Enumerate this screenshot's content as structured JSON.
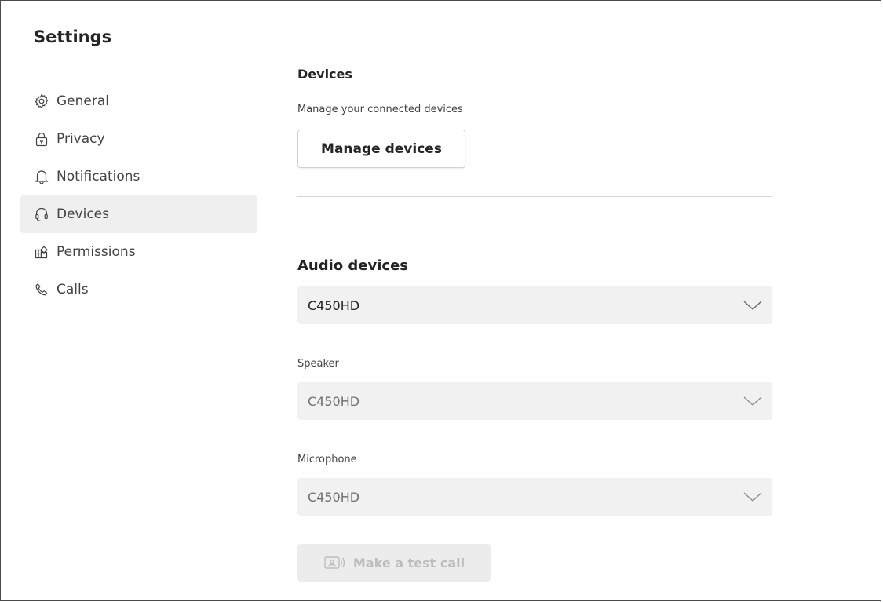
{
  "window": {
    "title": "Settings"
  },
  "sidebar": {
    "items": [
      {
        "label": "General",
        "icon": "gear-icon",
        "active": false
      },
      {
        "label": "Privacy",
        "icon": "lock-icon",
        "active": false
      },
      {
        "label": "Notifications",
        "icon": "bell-icon",
        "active": false
      },
      {
        "label": "Devices",
        "icon": "headset-icon",
        "active": true
      },
      {
        "label": "Permissions",
        "icon": "app-grid-icon",
        "active": false
      },
      {
        "label": "Calls",
        "icon": "phone-icon",
        "active": false
      }
    ]
  },
  "devices": {
    "title": "Devices",
    "description": "Manage your connected devices",
    "manage_button": "Manage devices"
  },
  "audio": {
    "title": "Audio devices",
    "device_value": "C450HD",
    "speaker_label": "Speaker",
    "speaker_value": "C450HD",
    "microphone_label": "Microphone",
    "microphone_value": "C450HD",
    "test_call_button": "Make a test call",
    "test_call_enabled": false
  },
  "colors": {
    "active_nav_bg": "#efefef",
    "select_bg": "#f1f1f1",
    "disabled_text": "#bdbdbd"
  }
}
